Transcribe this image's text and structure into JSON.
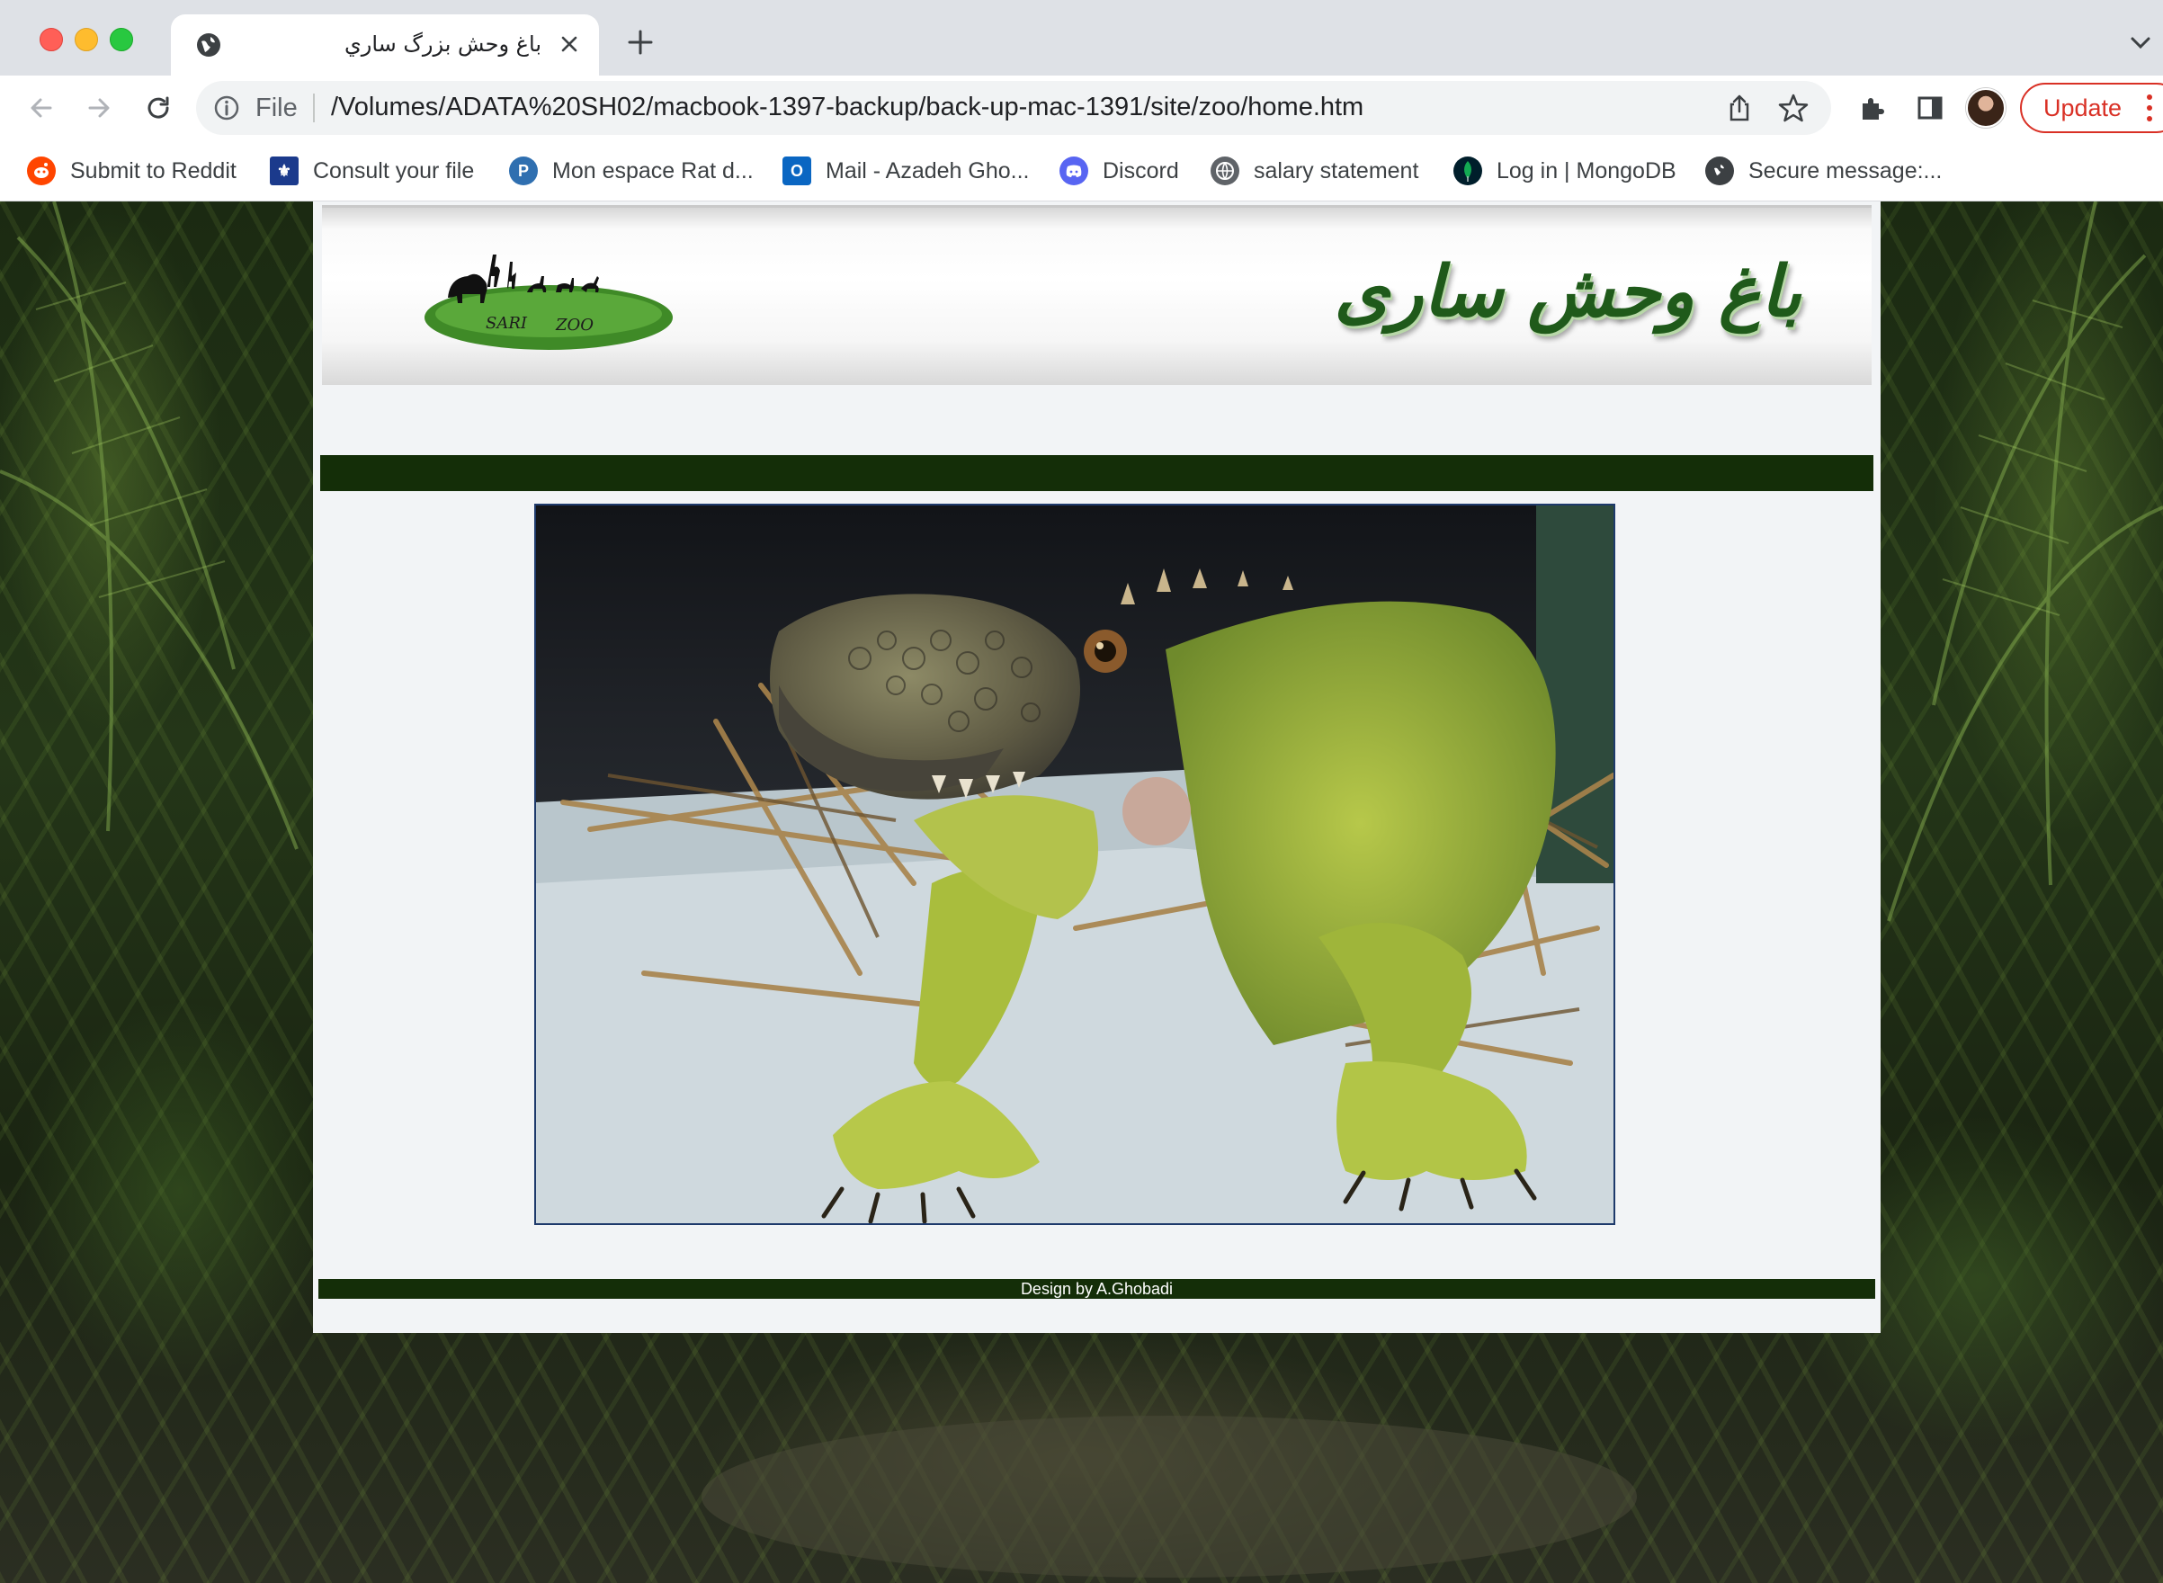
{
  "browser": {
    "tab": {
      "title": "باغ وحش بزرگ ساري",
      "favicon": "globe-icon"
    },
    "address_bar": {
      "scheme": "File",
      "url": "/Volumes/ADATA%20SH02/macbook-1397-backup/back-up-mac-1391/site/zoo/home.htm"
    },
    "update_label": "Update",
    "bookmarks": [
      {
        "label": "Submit to Reddit",
        "icon": "reddit-icon",
        "color": "#ff4500"
      },
      {
        "label": "Consult your file",
        "icon": "fleur-de-lis-icon",
        "color": "#1b3a8c"
      },
      {
        "label": "Mon espace Rat d...",
        "icon": "p-badge-icon",
        "color": "#2f6fb0"
      },
      {
        "label": "Mail - Azadeh Gho...",
        "icon": "outlook-icon",
        "color": "#0a66c2"
      },
      {
        "label": "Discord",
        "icon": "discord-icon",
        "color": "#5865f2"
      },
      {
        "label": "salary statement",
        "icon": "globe-icon",
        "color": "#5f6368"
      },
      {
        "label": "Log in | MongoDB",
        "icon": "mongodb-leaf-icon",
        "color": "#13aa52"
      },
      {
        "label": "Secure message:...",
        "icon": "globe-icon",
        "color": "#5f6368"
      }
    ]
  },
  "page": {
    "site_title": "باغ وحش ساری",
    "logo_text_left": "SARI",
    "logo_text_right": "ZOO",
    "footer": "Design by A.Ghobadi",
    "colors": {
      "dark_green": "#142e08",
      "panel": "#f2f4f6",
      "title_green": "#1f5a1a"
    }
  }
}
